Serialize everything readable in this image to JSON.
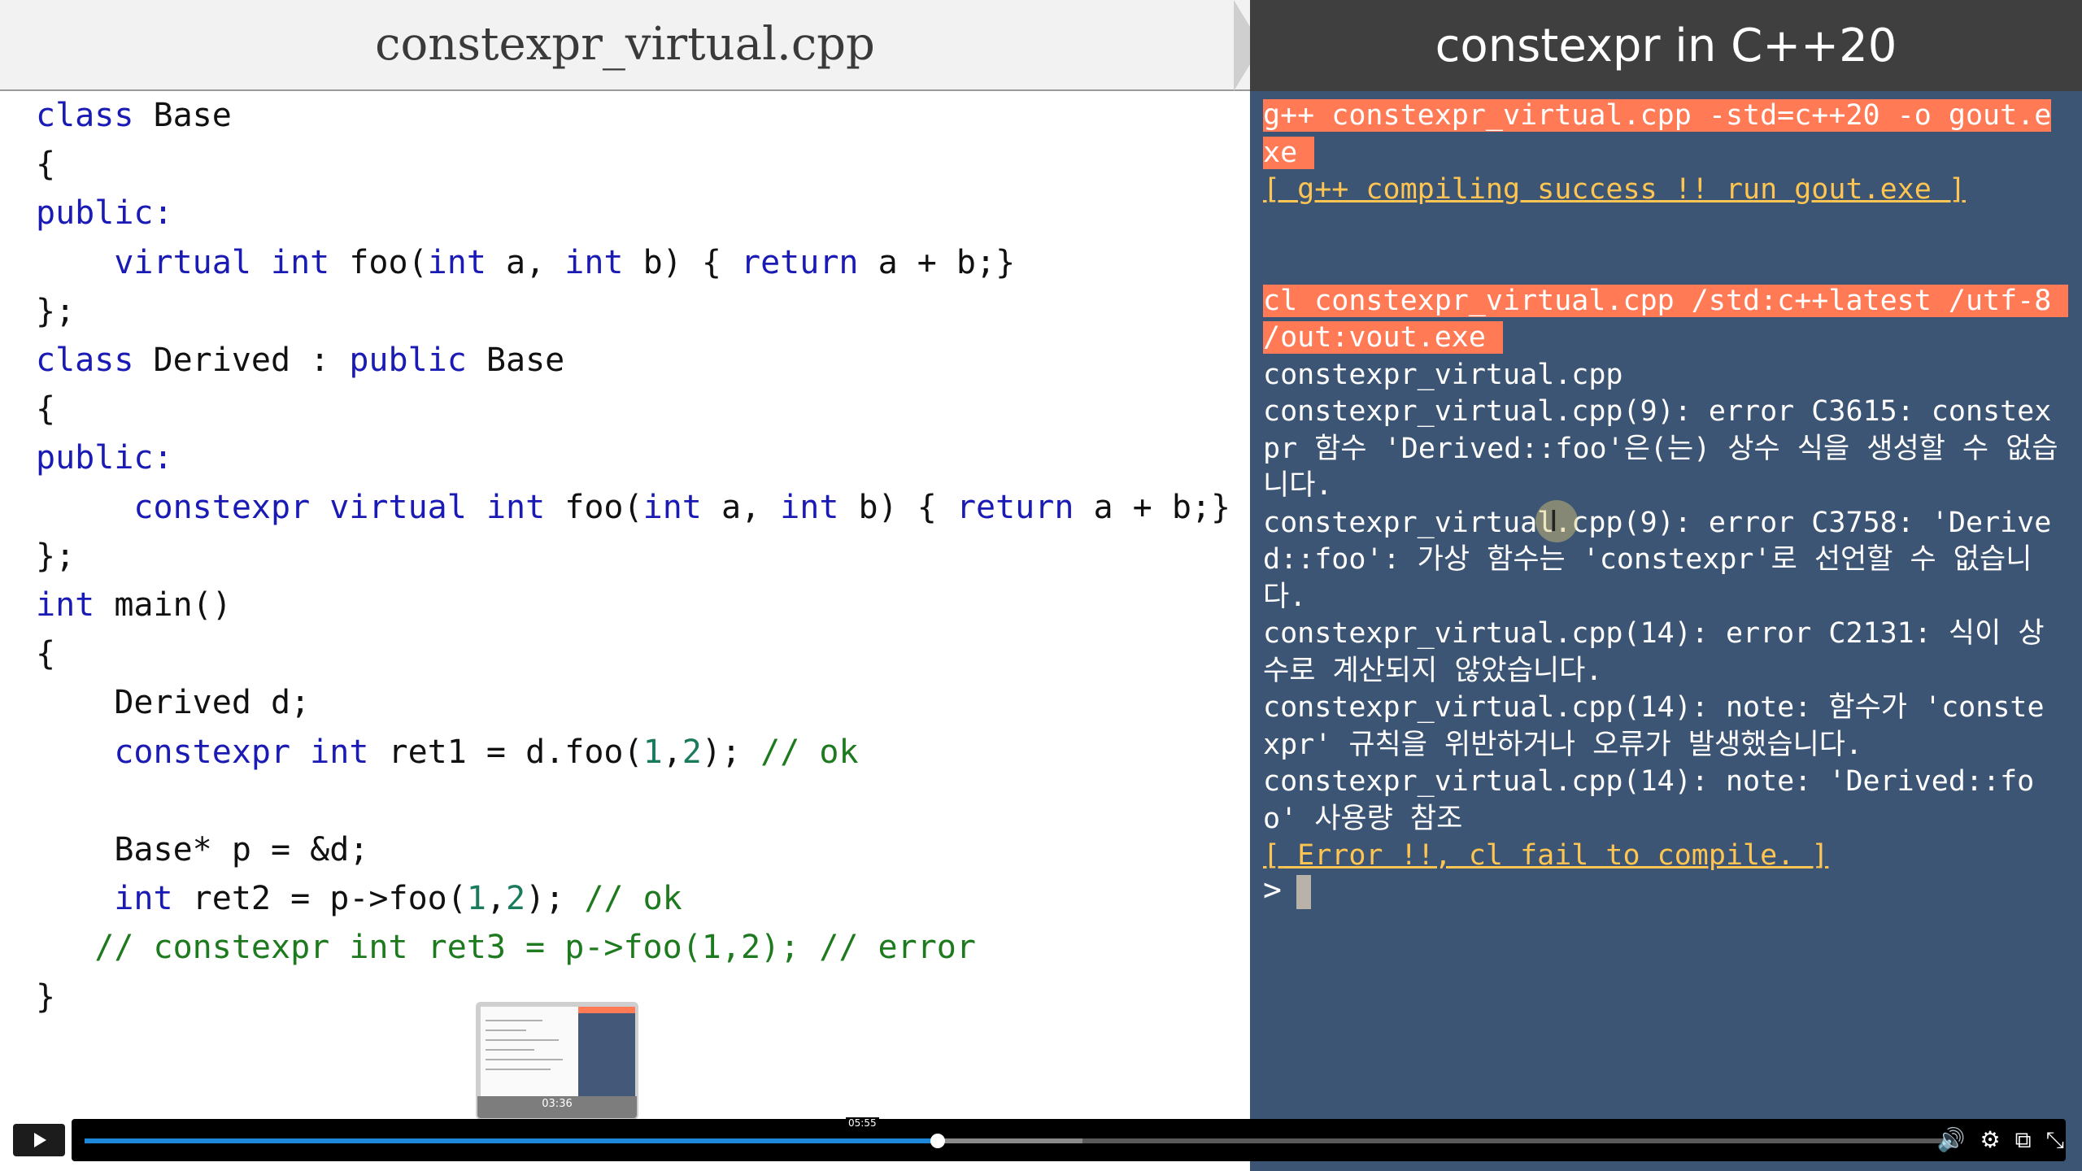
{
  "left_pane": {
    "title": "constexpr_virtual.cpp",
    "code_lines": [
      [
        {
          "t": "class",
          "c": "kw"
        },
        {
          "t": " Base"
        }
      ],
      [
        {
          "t": "{"
        }
      ],
      [
        {
          "t": "public:",
          "c": "kw"
        }
      ],
      [
        {
          "t": "    "
        },
        {
          "t": "virtual",
          "c": "kw"
        },
        {
          "t": " "
        },
        {
          "t": "int",
          "c": "kw"
        },
        {
          "t": " foo("
        },
        {
          "t": "int",
          "c": "kw"
        },
        {
          "t": " a, "
        },
        {
          "t": "int",
          "c": "kw"
        },
        {
          "t": " b) { "
        },
        {
          "t": "return",
          "c": "kw"
        },
        {
          "t": " a + b;}"
        }
      ],
      [
        {
          "t": "};"
        }
      ],
      [
        {
          "t": "class",
          "c": "kw"
        },
        {
          "t": " Derived : "
        },
        {
          "t": "public",
          "c": "kw"
        },
        {
          "t": " Base"
        }
      ],
      [
        {
          "t": "{"
        }
      ],
      [
        {
          "t": "public:",
          "c": "kw"
        }
      ],
      [
        {
          "t": "     "
        },
        {
          "t": "constexpr",
          "c": "kw"
        },
        {
          "t": " "
        },
        {
          "t": "virtual",
          "c": "kw"
        },
        {
          "t": " "
        },
        {
          "t": "int",
          "c": "kw"
        },
        {
          "t": " foo("
        },
        {
          "t": "int",
          "c": "kw"
        },
        {
          "t": " a, "
        },
        {
          "t": "int",
          "c": "kw"
        },
        {
          "t": " b) { "
        },
        {
          "t": "return",
          "c": "kw"
        },
        {
          "t": " a + b;}"
        }
      ],
      [
        {
          "t": "};"
        }
      ],
      [
        {
          "t": "int",
          "c": "kw"
        },
        {
          "t": " main()"
        }
      ],
      [
        {
          "t": "{"
        }
      ],
      [
        {
          "t": "    Derived d;"
        }
      ],
      [
        {
          "t": "    "
        },
        {
          "t": "constexpr",
          "c": "kw"
        },
        {
          "t": " "
        },
        {
          "t": "int",
          "c": "kw"
        },
        {
          "t": " ret1 = d.foo("
        },
        {
          "t": "1",
          "c": "num"
        },
        {
          "t": ","
        },
        {
          "t": "2",
          "c": "num"
        },
        {
          "t": "); "
        },
        {
          "t": "// ok",
          "c": "cm"
        }
      ],
      [
        {
          "t": ""
        }
      ],
      [
        {
          "t": "    Base* p = &d;"
        }
      ],
      [
        {
          "t": "    "
        },
        {
          "t": "int",
          "c": "kw"
        },
        {
          "t": " ret2 = p->foo("
        },
        {
          "t": "1",
          "c": "num"
        },
        {
          "t": ","
        },
        {
          "t": "2",
          "c": "num"
        },
        {
          "t": "); "
        },
        {
          "t": "// ok",
          "c": "cm"
        }
      ],
      [
        {
          "t": "   "
        },
        {
          "t": "// constexpr int ret3 = p->foo(1,2); // error",
          "c": "cm"
        }
      ],
      [
        {
          "t": "}"
        }
      ]
    ]
  },
  "right_pane": {
    "title": "constexpr in C++20",
    "terminal": [
      {
        "text": "g++ constexpr_virtual.cpp -std=c++20 -o gout.exe ",
        "style": "hl"
      },
      {
        "text": "[ g++ compiling success !! run gout.exe ]",
        "style": "ok"
      },
      {
        "text": "",
        "style": "gap"
      },
      {
        "text": "cl constexpr_virtual.cpp /std:c++latest /utf-8 /out:vout.exe ",
        "style": "hl"
      },
      {
        "text": "constexpr_virtual.cpp",
        "style": "plain"
      },
      {
        "text": "constexpr_virtual.cpp(9): error C3615: constexpr 함수 'Derived::foo'은(는) 상수 식을 생성할 수 없습니다.",
        "style": "plain"
      },
      {
        "text": "constexpr_virtual.cpp(9): error C3758: 'Derived::foo': 가상 함수는 'constexpr'로 선언할 수 없습니다.",
        "style": "plain"
      },
      {
        "text": "constexpr_virtual.cpp(14): error C2131: 식이 상수로 계산되지 않았습니다.",
        "style": "plain"
      },
      {
        "text": "constexpr_virtual.cpp(14): note: 함수가 'constexpr' 규칙을 위반하거나 오류가 발생했습니다.",
        "style": "plain"
      },
      {
        "text": "constexpr_virtual.cpp(14): note: 'Derived::foo' 사용량 참조",
        "style": "plain"
      },
      {
        "text": "[ Error !!, cl fail to compile. ]",
        "style": "ok"
      }
    ],
    "prompt": ">"
  },
  "player": {
    "hover_time": "05:55",
    "thumbnail_time": "03:36",
    "progress": 0.458,
    "buffered": 0.536,
    "icons": [
      "volume-icon",
      "settings-icon",
      "miniplayer-icon",
      "fullscreen-exit-icon"
    ],
    "icon_glyphs": [
      "🔊",
      "⚙",
      "⧉",
      "⤡"
    ]
  }
}
